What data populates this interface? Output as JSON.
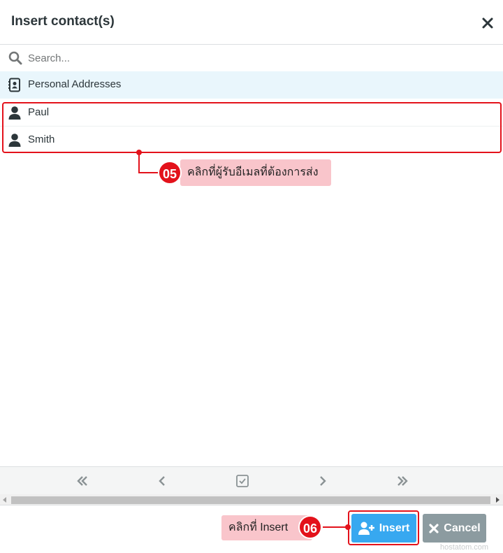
{
  "dialog": {
    "title": "Insert contact(s)"
  },
  "search": {
    "placeholder": "Search..."
  },
  "list": {
    "group_label": "Personal Addresses",
    "contacts": [
      {
        "label": "Paul"
      },
      {
        "label": "Smith"
      }
    ]
  },
  "annotations": {
    "step5_number": "05",
    "step5_text": "คลิกที่ผู้รับอีเมลที่ต้องการส่ง",
    "step6_number": "06",
    "step6_text": "คลิกที่ Insert"
  },
  "pager": {
    "icons": [
      "first-page-icon",
      "prev-page-icon",
      "select-all-icon",
      "next-page-icon",
      "last-page-icon"
    ]
  },
  "footer": {
    "insert_label": "Insert",
    "cancel_label": "Cancel"
  },
  "watermark": "hostatom.com",
  "colors": {
    "accent_blue": "#37a8f0",
    "cancel_gray": "#8c9ba0",
    "annotation_red": "#e3121b",
    "annotation_pink": "#f9c5cb",
    "selected_row": "#e9f6fc"
  }
}
